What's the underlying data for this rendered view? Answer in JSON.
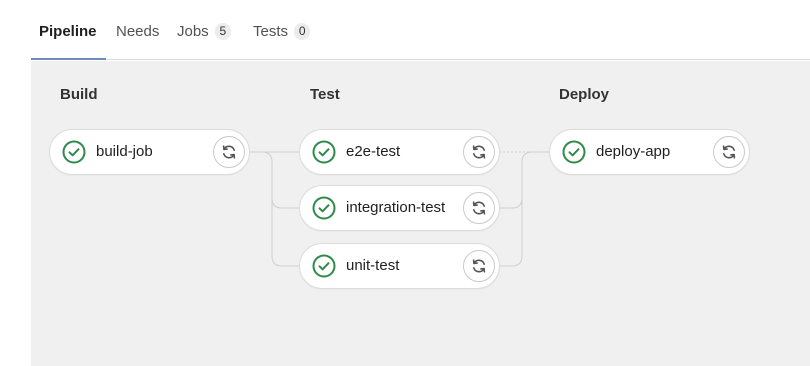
{
  "tabs": [
    {
      "label": "Pipeline"
    },
    {
      "label": "Needs"
    },
    {
      "label": "Jobs",
      "count": "5"
    },
    {
      "label": "Tests",
      "count": "0"
    }
  ],
  "colors": {
    "success": "#2f8a4a",
    "active_tab_underline": "#6f8bb8",
    "pipeline_background": "#f0f0f0"
  },
  "stages": [
    {
      "title": "Build",
      "jobs": [
        {
          "name": "build-job",
          "status_icon": "status-success-icon",
          "action_icon": "retry-icon"
        }
      ]
    },
    {
      "title": "Test",
      "jobs": [
        {
          "name": "e2e-test",
          "status_icon": "status-success-icon",
          "action_icon": "retry-icon"
        },
        {
          "name": "integration-test",
          "status_icon": "status-success-icon",
          "action_icon": "retry-icon"
        },
        {
          "name": "unit-test",
          "status_icon": "status-success-icon",
          "action_icon": "retry-icon"
        }
      ]
    },
    {
      "title": "Deploy",
      "jobs": [
        {
          "name": "deploy-app",
          "status_icon": "status-success-icon",
          "action_icon": "retry-icon"
        }
      ]
    }
  ]
}
